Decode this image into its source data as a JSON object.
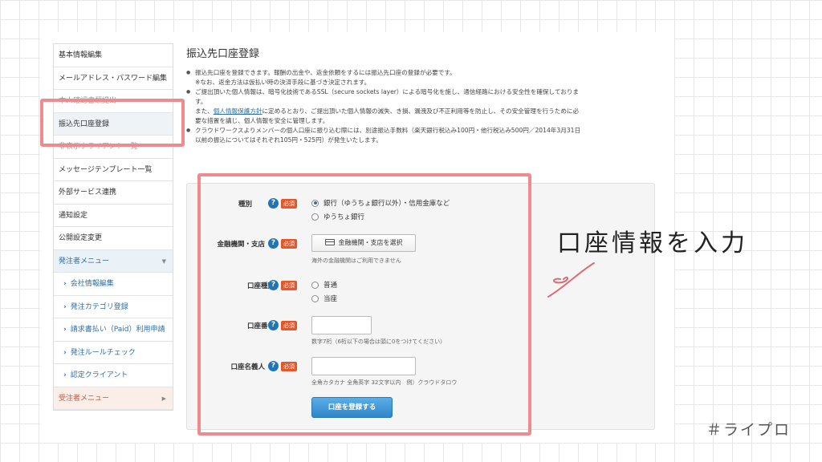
{
  "sidebar": {
    "items": [
      {
        "label": "基本情報編集"
      },
      {
        "label": "メールアドレス・パスワード編集"
      },
      {
        "label": "本人確認書類提出"
      },
      {
        "label": "振込先口座登録"
      },
      {
        "label": "非表示クライアント一覧"
      },
      {
        "label": "メッセージテンプレート一覧"
      },
      {
        "label": "外部サービス連携"
      },
      {
        "label": "通知設定"
      },
      {
        "label": "公開設定変更"
      }
    ],
    "orderer_menu": {
      "label": "発注者メニュー",
      "items": [
        {
          "label": "会社情報編集"
        },
        {
          "label": "発注カテゴリ登録"
        },
        {
          "label": "請求書払い（Paid）利用申請"
        },
        {
          "label": "発注ルールチェック"
        },
        {
          "label": "認定クライアント"
        }
      ]
    },
    "receiver_menu": {
      "label": "受注者メニュー"
    }
  },
  "page": {
    "title": "振込先口座登録",
    "notes": [
      {
        "line1": "振込先口座を登録できます。報酬の出金や、返金依頼をするには振込先口座の登録が必要です。",
        "line2": "※なお、返金方法は仮払い時の決済手段に基づき決定されます。"
      },
      {
        "pre": "ご提出頂いた個人情報は、暗号化技術であるSSL（secure sockets layer）による暗号化を施し、通信経路における安全性を確保しておりま",
        "cont": "す。"
      },
      {
        "pre": "また、",
        "link": "個人情報保護方針",
        "post": "に定めるとおり、ご提出頂いた個人情報の滅失、き損、漏洩及び不正利用等を防止し、その安全管理を行うために必",
        "cont": "要な措置を講じ、個人情報を安全に管理します。"
      },
      {
        "line1": "クラウドワークスよりメンバーの個人口座に振り込む際には、別途振込手数料（楽天銀行税込み100円・他行税込み500円／2014年3月31日",
        "line2": "以前の振込についてはそれぞれ105円・525円）が発生いたします。"
      }
    ]
  },
  "form": {
    "required_label": "必須",
    "help_glyph": "?",
    "type": {
      "label": "種別",
      "options": [
        "銀行（ゆうちょ銀行以外）・信用金庫など",
        "ゆうちょ銀行"
      ],
      "selected": 0
    },
    "bank": {
      "label": "金融機関・支店",
      "button": "金融機関・支店を選択",
      "hint": "海外の金融機関はご利用できません"
    },
    "account_type": {
      "label": "口座種別",
      "options": [
        "普通",
        "当座"
      ]
    },
    "account_number": {
      "label": "口座番号",
      "value": "",
      "hint": "数字7桁（6桁以下の場合は頭に0をつけてください）"
    },
    "account_holder": {
      "label": "口座名義人",
      "value": "",
      "hint": "全角カタカナ 全角英字 32文字以内　例）クラウドタロウ"
    },
    "submit": "口座を登録する"
  },
  "annotation": {
    "handwritten": "口座情報を入力",
    "brand": "＃ライプロ",
    "highlight_color": "#f08a8d"
  }
}
